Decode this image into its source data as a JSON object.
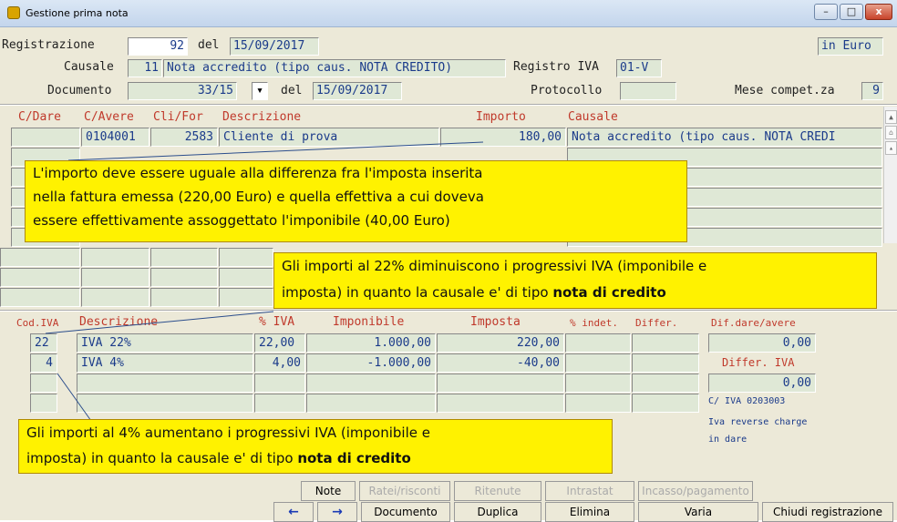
{
  "window": {
    "title": "Gestione prima nota",
    "min": "–",
    "max": "□",
    "close": "x"
  },
  "header": {
    "registrazione_label": "Registrazione",
    "registrazione_value": "92",
    "del_label": "del",
    "registrazione_date": "15/09/2017",
    "currency": "in Euro",
    "causale_label": "Causale",
    "causale_code": "11",
    "causale_desc": "Nota accredito (tipo caus. NOTA CREDITO)",
    "registro_iva_label": "Registro IVA",
    "registro_iva_value": "01-V",
    "documento_label": "Documento",
    "documento_value": "33/15",
    "documento_del_label": "del",
    "documento_date": "15/09/2017",
    "protocollo_label": "Protocollo",
    "protocollo_value": "",
    "mese_label": "Mese compet.za",
    "mese_value": "9"
  },
  "entries": {
    "headers": [
      "C/Dare",
      "C/Avere",
      "Cli/For",
      "Descrizione",
      "Importo",
      "Causale"
    ],
    "row1": {
      "cdare": "",
      "cavere": "0104001",
      "clifor": "2583",
      "desc": "Cliente di prova",
      "importo": "180,00",
      "causale": "Nota accredito (tipo caus. NOTA CREDI"
    }
  },
  "iva": {
    "headers": [
      "Cod.IVA",
      "Descrizione",
      "% IVA",
      "Imponibile",
      "Imposta",
      "% indet.",
      "Differ."
    ],
    "rows": [
      {
        "cod": "22",
        "desc": "IVA 22%",
        "perc": "22,00",
        "imponibile": "1.000,00",
        "imposta": "220,00"
      },
      {
        "cod": "4",
        "desc": "IVA 4%",
        "perc": "4,00",
        "imponibile": "-1.000,00",
        "imposta": "-40,00"
      }
    ]
  },
  "side": {
    "dif_label": "Dif.dare/avere",
    "dif_value": "0,00",
    "differ_iva_label": "Differ. IVA",
    "differ_iva_value": "0,00",
    "civa": "C/ IVA 0203003",
    "reverse": "Iva reverse charge",
    "in_dare": "in dare"
  },
  "notes": {
    "n1_l1": "L'importo deve essere uguale alla differenza fra l'imposta inserita",
    "n1_l2": "nella fattura emessa (220,00 Euro) e quella effettiva a cui doveva",
    "n1_l3": "essere effettivamente assoggettato l'imponibile (40,00 Euro)",
    "n2_l1": "Gli importi al 22% diminuiscono i progressivi IVA (imponibile e",
    "n2_l2": "imposta) in quanto la causale e' di tipo ",
    "n2_bold": "nota di credito",
    "n3_l1": "Gli importi al 4% aumentano i progressivi IVA (imponibile e",
    "n3_l2": "imposta) in quanto la causale e' di tipo ",
    "n3_bold": "nota di credito"
  },
  "buttons": {
    "note": "Note",
    "ratei": "Ratei/risconti",
    "ritenute": "Ritenute",
    "intrastat": "Intrastat",
    "incasso": "Incasso/pagamento",
    "prev": "←",
    "next": "→",
    "documento": "Documento",
    "duplica": "Duplica",
    "elimina": "Elimina",
    "varia": "Varia",
    "chiudi": "Chiudi registrazione"
  }
}
